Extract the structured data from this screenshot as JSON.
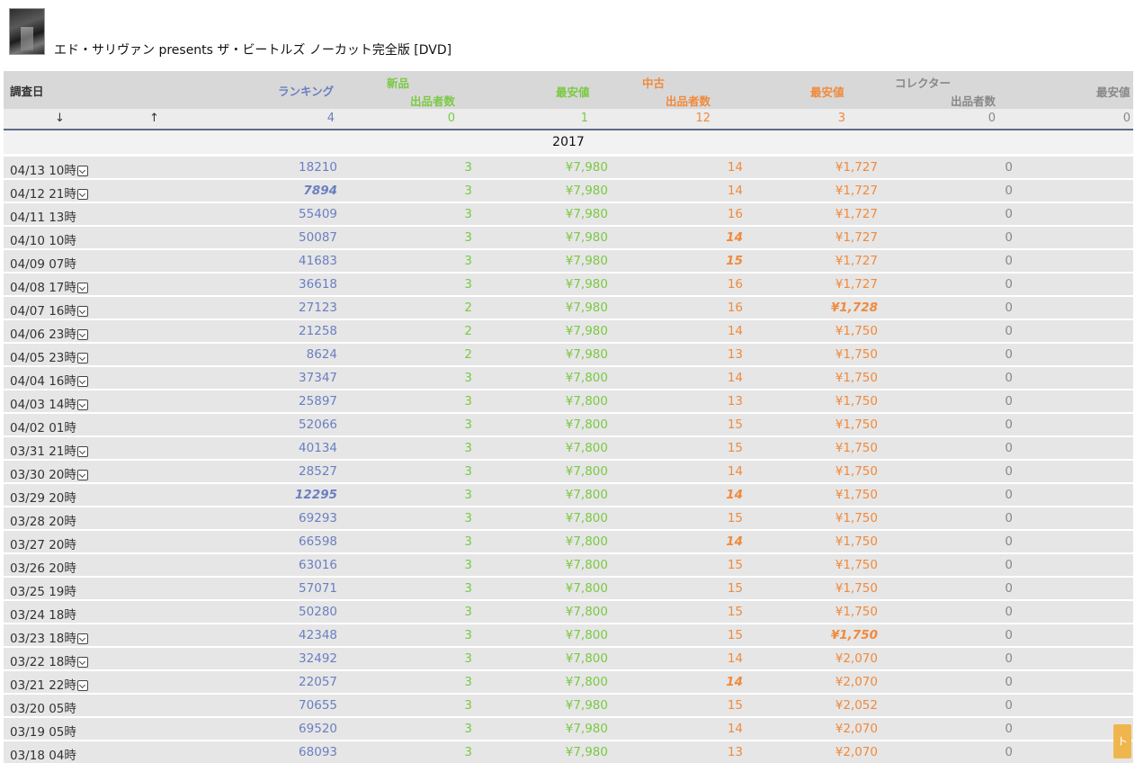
{
  "product": {
    "title": "エド・サリヴァン presents ザ・ビートルズ ノーカット完全版 [DVD]",
    "thumbnail_icon": "dvd-cover-thumbnail"
  },
  "table": {
    "headers": {
      "date": "調査日",
      "ranking": "ランキング",
      "new_group": "新品",
      "new_count": "出品者数",
      "new_price": "最安値",
      "used_group": "中古",
      "used_count": "出品者数",
      "used_price": "最安値",
      "collector_group": "コレクター",
      "collector_count": "出品者数",
      "collector_price": "最安値"
    },
    "sort": {
      "desc_arrow": "↓",
      "asc_arrow": "↑"
    },
    "summary": {
      "ranking": "4",
      "new_count": "0",
      "new_price": "1",
      "used_count": "12",
      "used_price": "3",
      "collector_count": "0",
      "collector_price": "0"
    },
    "year": "2017",
    "rows": [
      {
        "date": "04/13 10時",
        "dd": true,
        "rank": "18210",
        "nc": "3",
        "np": "¥7,980",
        "uc": "14",
        "up": "¥1,727",
        "cc": "0"
      },
      {
        "date": "04/12 21時",
        "dd": true,
        "rank": "7894",
        "rank_hl": true,
        "nc": "3",
        "np": "¥7,980",
        "uc": "14",
        "up": "¥1,727",
        "cc": "0"
      },
      {
        "date": "04/11 13時",
        "dd": false,
        "rank": "55409",
        "nc": "3",
        "np": "¥7,980",
        "uc": "16",
        "up": "¥1,727",
        "cc": "0"
      },
      {
        "date": "04/10 10時",
        "dd": false,
        "rank": "50087",
        "nc": "3",
        "np": "¥7,980",
        "uc": "14",
        "uc_hl": true,
        "up": "¥1,727",
        "cc": "0"
      },
      {
        "date": "04/09 07時",
        "dd": false,
        "rank": "41683",
        "nc": "3",
        "np": "¥7,980",
        "uc": "15",
        "uc_hl": true,
        "up": "¥1,727",
        "cc": "0"
      },
      {
        "date": "04/08 17時",
        "dd": true,
        "rank": "36618",
        "nc": "3",
        "np": "¥7,980",
        "uc": "16",
        "up": "¥1,727",
        "cc": "0"
      },
      {
        "date": "04/07 16時",
        "dd": true,
        "rank": "27123",
        "nc": "2",
        "np": "¥7,980",
        "uc": "16",
        "up": "¥1,728",
        "up_hl": true,
        "cc": "0"
      },
      {
        "date": "04/06 23時",
        "dd": true,
        "rank": "21258",
        "nc": "2",
        "np": "¥7,980",
        "uc": "14",
        "up": "¥1,750",
        "cc": "0"
      },
      {
        "date": "04/05 23時",
        "dd": true,
        "rank": "8624",
        "nc": "2",
        "np": "¥7,980",
        "uc": "13",
        "up": "¥1,750",
        "cc": "0"
      },
      {
        "date": "04/04 16時",
        "dd": true,
        "rank": "37347",
        "nc": "3",
        "np": "¥7,800",
        "uc": "14",
        "up": "¥1,750",
        "cc": "0"
      },
      {
        "date": "04/03 14時",
        "dd": true,
        "rank": "25897",
        "nc": "3",
        "np": "¥7,800",
        "uc": "13",
        "up": "¥1,750",
        "cc": "0"
      },
      {
        "date": "04/02 01時",
        "dd": false,
        "rank": "52066",
        "nc": "3",
        "np": "¥7,800",
        "uc": "15",
        "up": "¥1,750",
        "cc": "0"
      },
      {
        "date": "03/31 21時",
        "dd": true,
        "rank": "40134",
        "nc": "3",
        "np": "¥7,800",
        "uc": "15",
        "up": "¥1,750",
        "cc": "0"
      },
      {
        "date": "03/30 20時",
        "dd": true,
        "rank": "28527",
        "nc": "3",
        "np": "¥7,800",
        "uc": "14",
        "up": "¥1,750",
        "cc": "0"
      },
      {
        "date": "03/29 20時",
        "dd": false,
        "rank": "12295",
        "rank_hl": true,
        "nc": "3",
        "np": "¥7,800",
        "uc": "14",
        "uc_hl": true,
        "up": "¥1,750",
        "cc": "0"
      },
      {
        "date": "03/28 20時",
        "dd": false,
        "rank": "69293",
        "nc": "3",
        "np": "¥7,800",
        "uc": "15",
        "up": "¥1,750",
        "cc": "0"
      },
      {
        "date": "03/27 20時",
        "dd": false,
        "rank": "66598",
        "nc": "3",
        "np": "¥7,800",
        "uc": "14",
        "uc_hl": true,
        "up": "¥1,750",
        "cc": "0"
      },
      {
        "date": "03/26 20時",
        "dd": false,
        "rank": "63016",
        "nc": "3",
        "np": "¥7,800",
        "uc": "15",
        "up": "¥1,750",
        "cc": "0"
      },
      {
        "date": "03/25 19時",
        "dd": false,
        "rank": "57071",
        "nc": "3",
        "np": "¥7,800",
        "uc": "15",
        "up": "¥1,750",
        "cc": "0"
      },
      {
        "date": "03/24 18時",
        "dd": false,
        "rank": "50280",
        "nc": "3",
        "np": "¥7,800",
        "uc": "15",
        "up": "¥1,750",
        "cc": "0"
      },
      {
        "date": "03/23 18時",
        "dd": true,
        "rank": "42348",
        "nc": "3",
        "np": "¥7,800",
        "uc": "15",
        "up": "¥1,750",
        "up_hl": true,
        "cc": "0"
      },
      {
        "date": "03/22 18時",
        "dd": true,
        "rank": "32492",
        "nc": "3",
        "np": "¥7,800",
        "uc": "14",
        "up": "¥2,070",
        "cc": "0"
      },
      {
        "date": "03/21 22時",
        "dd": true,
        "rank": "22057",
        "nc": "3",
        "np": "¥7,800",
        "uc": "14",
        "uc_hl": true,
        "up": "¥2,070",
        "cc": "0"
      },
      {
        "date": "03/20 05時",
        "dd": false,
        "rank": "70655",
        "nc": "3",
        "np": "¥7,980",
        "uc": "15",
        "up": "¥2,052",
        "cc": "0"
      },
      {
        "date": "03/19 05時",
        "dd": false,
        "rank": "69520",
        "nc": "3",
        "np": "¥7,980",
        "uc": "14",
        "up": "¥2,070",
        "cc": "0"
      },
      {
        "date": "03/18 04時",
        "dd": false,
        "rank": "68093",
        "nc": "3",
        "np": "¥7,980",
        "uc": "13",
        "up": "¥2,070",
        "cc": "0"
      }
    ]
  },
  "scroll_top_label": "ト"
}
